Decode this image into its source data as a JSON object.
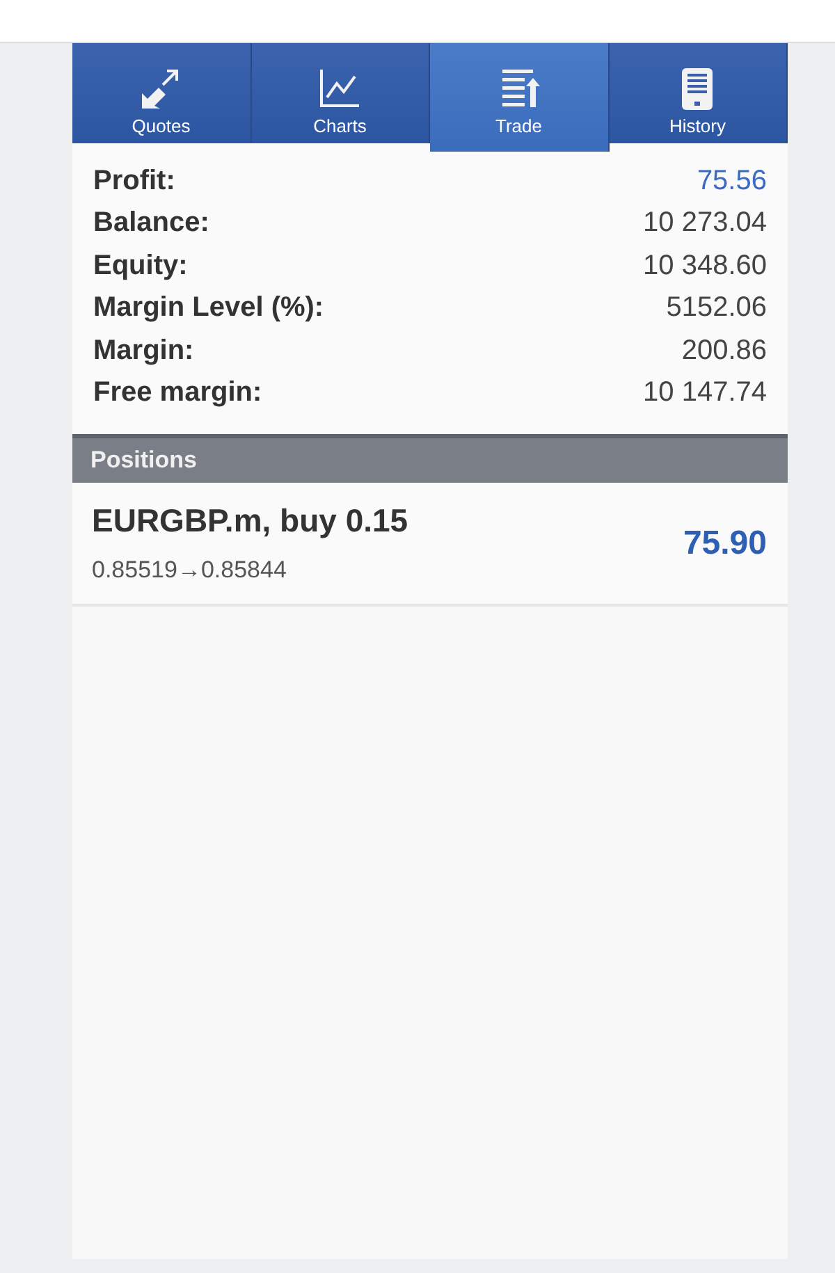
{
  "tabs": [
    {
      "label": "Quotes",
      "kind": "arrows",
      "selected": false
    },
    {
      "label": "Charts",
      "kind": "chart",
      "selected": false
    },
    {
      "label": "Trade",
      "kind": "list",
      "selected": true
    },
    {
      "label": "History",
      "kind": "tablet",
      "selected": false
    }
  ],
  "summary": [
    {
      "label": "Profit:",
      "value": "75.56",
      "accent": true
    },
    {
      "label": "Balance:",
      "value": "10 273.04",
      "accent": false
    },
    {
      "label": "Equity:",
      "value": "10 348.60",
      "accent": false
    },
    {
      "label": "Margin Level (%):",
      "value": "5152.06",
      "accent": false
    },
    {
      "label": "Margin:",
      "value": "200.86",
      "accent": false
    },
    {
      "label": "Free margin:",
      "value": "10 147.74",
      "accent": false
    }
  ],
  "positions": {
    "title": "Positions",
    "items": [
      {
        "symbol": "EURGBP.m, buy 0.15",
        "prices": "0.85519→0.85844",
        "profit": "75.90"
      }
    ]
  }
}
